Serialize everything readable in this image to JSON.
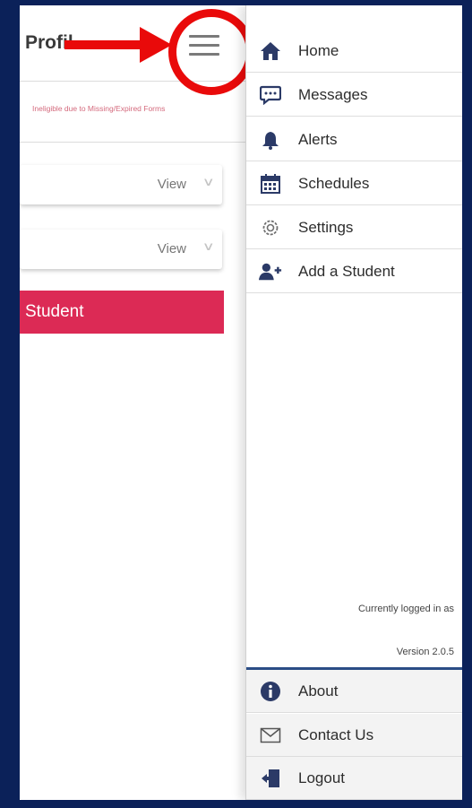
{
  "page": {
    "title": "Profil",
    "status_message": "Ineligible due to Missing/Expired Forms",
    "view_rows": [
      {
        "label": "View"
      },
      {
        "label": "View"
      }
    ],
    "add_student_label": "Student"
  },
  "drawer": {
    "items": [
      {
        "label": "Home",
        "icon": "home-icon"
      },
      {
        "label": "Messages",
        "icon": "messages-icon"
      },
      {
        "label": "Alerts",
        "icon": "bell-icon"
      },
      {
        "label": "Schedules",
        "icon": "calendar-icon"
      },
      {
        "label": "Settings",
        "icon": "gear-icon"
      },
      {
        "label": "Add a Student",
        "icon": "add-user-icon"
      }
    ],
    "logged_in_text": "Currently logged in as",
    "version_text": "Version 2.0.5",
    "footer": [
      {
        "label": "About",
        "icon": "info-icon"
      },
      {
        "label": "Contact Us",
        "icon": "envelope-icon"
      },
      {
        "label": "Logout",
        "icon": "logout-icon"
      }
    ]
  },
  "colors": {
    "frame_border": "#0b2159",
    "accent_red": "#dc2a55",
    "annotation_red": "#e90a0a",
    "icon_navy": "#2b3a67"
  }
}
